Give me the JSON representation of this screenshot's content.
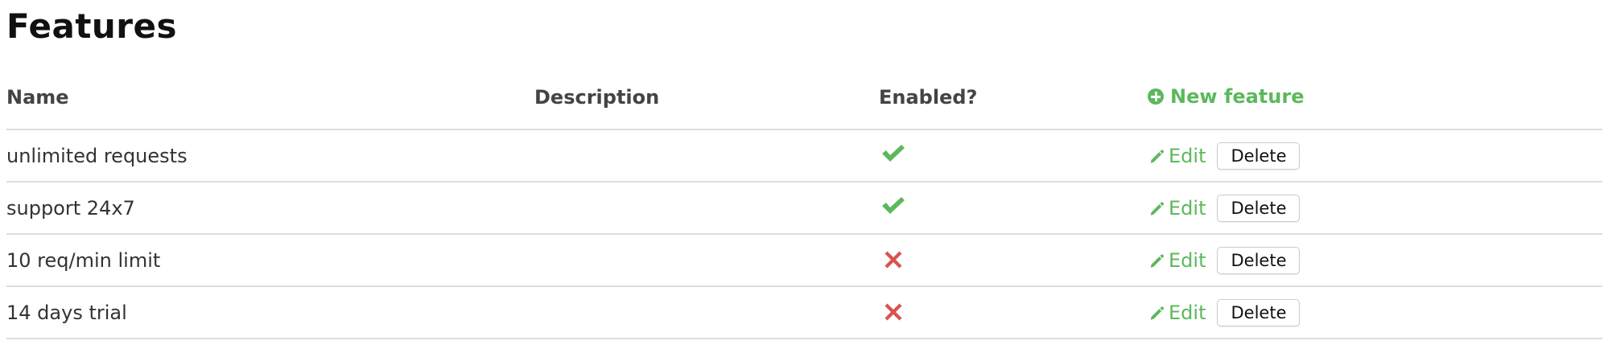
{
  "page": {
    "title": "Features"
  },
  "table": {
    "headers": {
      "name": "Name",
      "description": "Description",
      "enabled": "Enabled?",
      "new_feature": "New feature"
    },
    "rows": [
      {
        "name": "unlimited requests",
        "description": "",
        "enabled": true,
        "edit_label": "Edit",
        "delete_label": "Delete"
      },
      {
        "name": "support 24x7",
        "description": "",
        "enabled": true,
        "edit_label": "Edit",
        "delete_label": "Delete"
      },
      {
        "name": "10 req/min limit",
        "description": "",
        "enabled": false,
        "edit_label": "Edit",
        "delete_label": "Delete"
      },
      {
        "name": "14 days trial",
        "description": "",
        "enabled": false,
        "edit_label": "Edit",
        "delete_label": "Delete"
      }
    ]
  },
  "icons": {
    "new_feature": "plus-circle-icon",
    "edit": "pencil-icon",
    "enabled_true": "checkmark-icon",
    "enabled_false": "cross-icon"
  },
  "colors": {
    "accent": "#5cb85c",
    "enabled_true": "#5cb85c",
    "enabled_false": "#d9534f",
    "divider": "#dddddd"
  }
}
